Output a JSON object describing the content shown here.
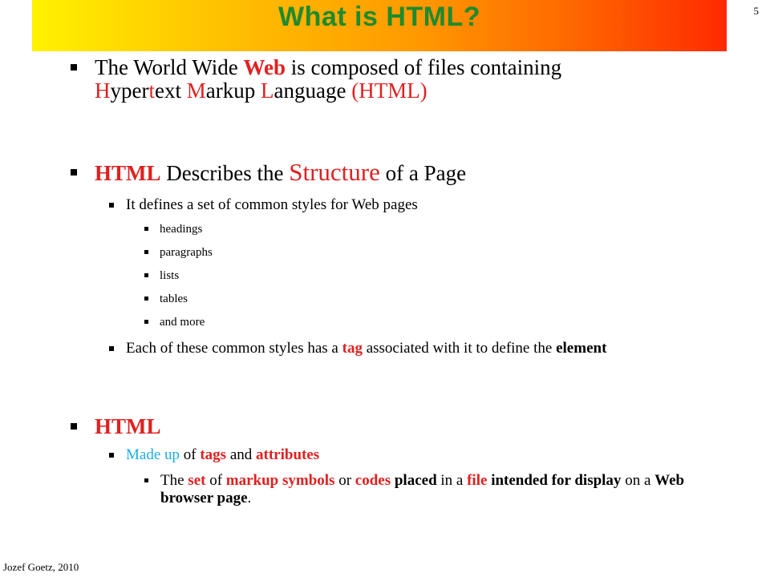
{
  "title": "What is HTML?",
  "slide_number": "5",
  "footer": "Jozef Goetz, 2010",
  "colors": {
    "title_text": "#1f8a2e",
    "accent_red": "#e02020",
    "accent_cyan": "#1aaee6"
  },
  "b1": {
    "p1": "The World Wide ",
    "web": "Web",
    "p2": " is composed of files containing",
    "h": "H",
    "ype": "ype",
    "r": "r",
    "t": "t",
    "ext": "ext ",
    "m": "M",
    "arkup": "arkup ",
    "l": "L",
    "anguage": "anguage ",
    "html": "(HTML)"
  },
  "b2": {
    "html": "HTML",
    "p1": " Describes the ",
    "structure": "Structure",
    "p2": " of a Page"
  },
  "b2_1": "It defines a set of common styles for Web pages",
  "styles_list": [
    "headings",
    "paragraphs",
    "lists",
    "tables",
    "and more"
  ],
  "b2_2": {
    "p1": "Each of these common styles has a ",
    "tag": "tag",
    "p2": " associated with it to define the ",
    "element": "element"
  },
  "b3": {
    "html": "HTML"
  },
  "b3_1": {
    "made_up": "Made up",
    "of": " of ",
    "tags": "tags",
    "and": " and ",
    "attributes": "attributes"
  },
  "b3_2": {
    "the": "The ",
    "set": "set",
    "of": " of ",
    "markup_symbols": "markup symbols",
    "or": " or ",
    "codes": "codes",
    "placed": " placed",
    "in_a": " in a ",
    "file": "file",
    "intended_for_display": " intended for display",
    "on_a": " on a ",
    "web_browser_page": "Web browser page",
    "dot": "."
  }
}
